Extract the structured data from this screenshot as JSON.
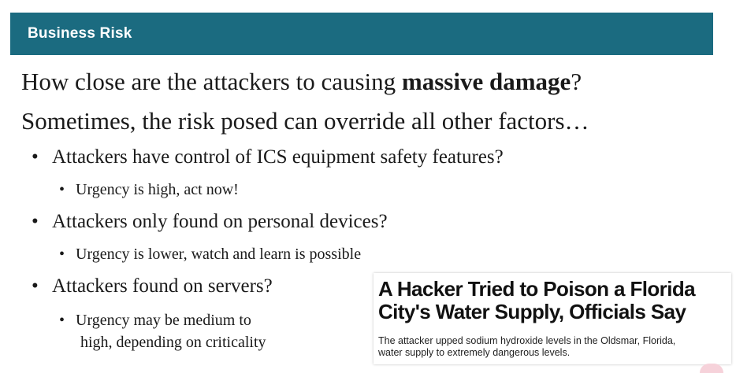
{
  "header": {
    "title": "Business Risk"
  },
  "question": {
    "prefix": "How close are the attackers to causing ",
    "emphasis": "massive damage",
    "suffix": "?"
  },
  "subtitle": "Sometimes, the risk posed can override all other factors…",
  "bullets": [
    {
      "text": "Attackers have control of ICS equipment safety features?",
      "sub": [
        "Urgency is high, act now!"
      ]
    },
    {
      "text": "Attackers only found on personal devices?",
      "sub": [
        "Urgency is lower, watch and learn is possible"
      ]
    },
    {
      "text": "Attackers found on servers?",
      "sub": [
        "Urgency may be medium to",
        "high, depending on criticality"
      ]
    }
  ],
  "news": {
    "headline_line1": "A Hacker Tried to Poison a Florida",
    "headline_line2": "City's Water Supply, Officials Say",
    "dek_line1": "The attacker upped sodium hydroxide levels in the Oldsmar, Florida,",
    "dek_line2": "water supply to extremely dangerous levels."
  },
  "bullet_char": "•"
}
